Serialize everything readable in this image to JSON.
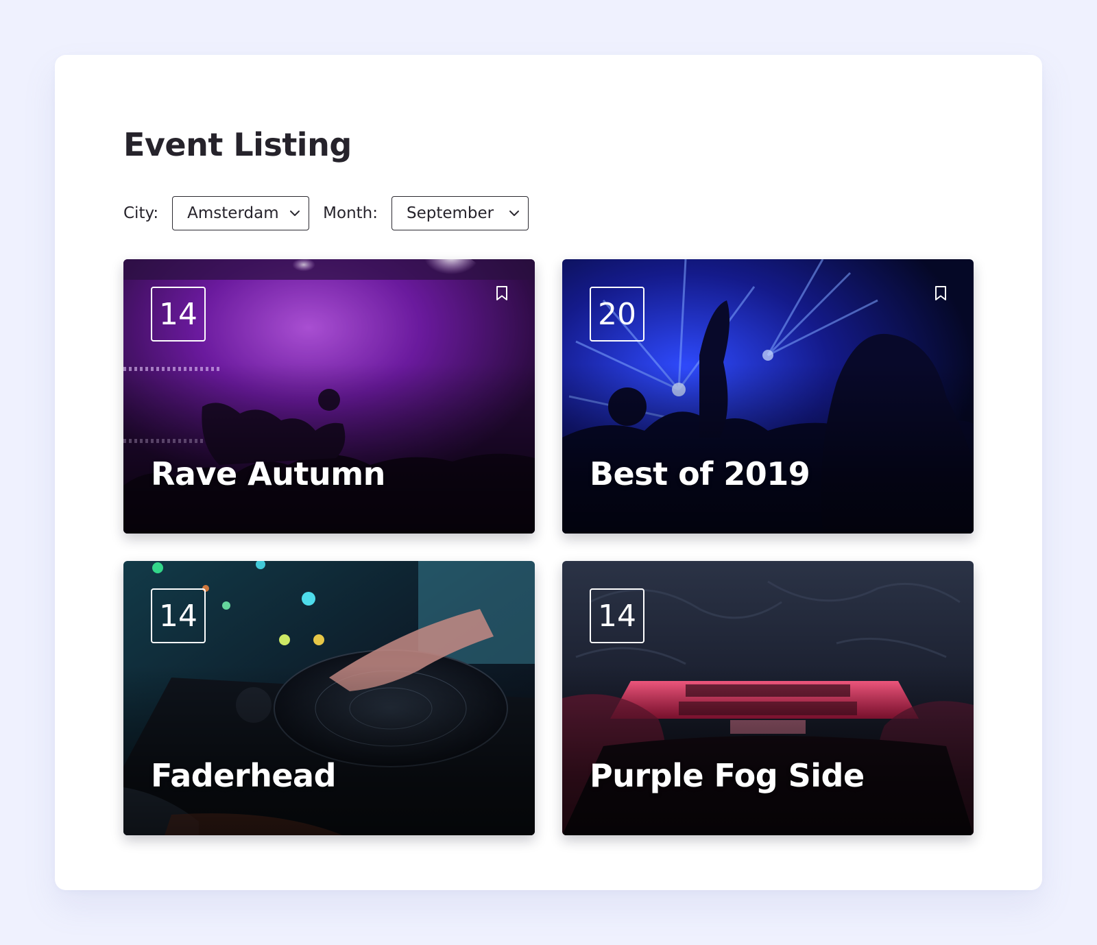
{
  "page": {
    "title": "Event Listing"
  },
  "filters": {
    "city_label": "City:",
    "city_value": "Amsterdam",
    "month_label": "Month:",
    "month_value": "September"
  },
  "events": [
    {
      "day": "14",
      "title": "Rave Autumn",
      "bookmark": "bookmark-icon",
      "accent": "#8a2bd6"
    },
    {
      "day": "20",
      "title": "Best of 2019",
      "bookmark": "bookmark-icon",
      "accent": "#2233c8"
    },
    {
      "day": "14",
      "title": "Faderhead",
      "accent": "#1c5a6e"
    },
    {
      "day": "14",
      "title": "Purple Fog Side",
      "accent": "#c4244e"
    }
  ],
  "colors": {
    "background": "#eff1fe",
    "panel": "#ffffff",
    "text": "#26232b"
  }
}
